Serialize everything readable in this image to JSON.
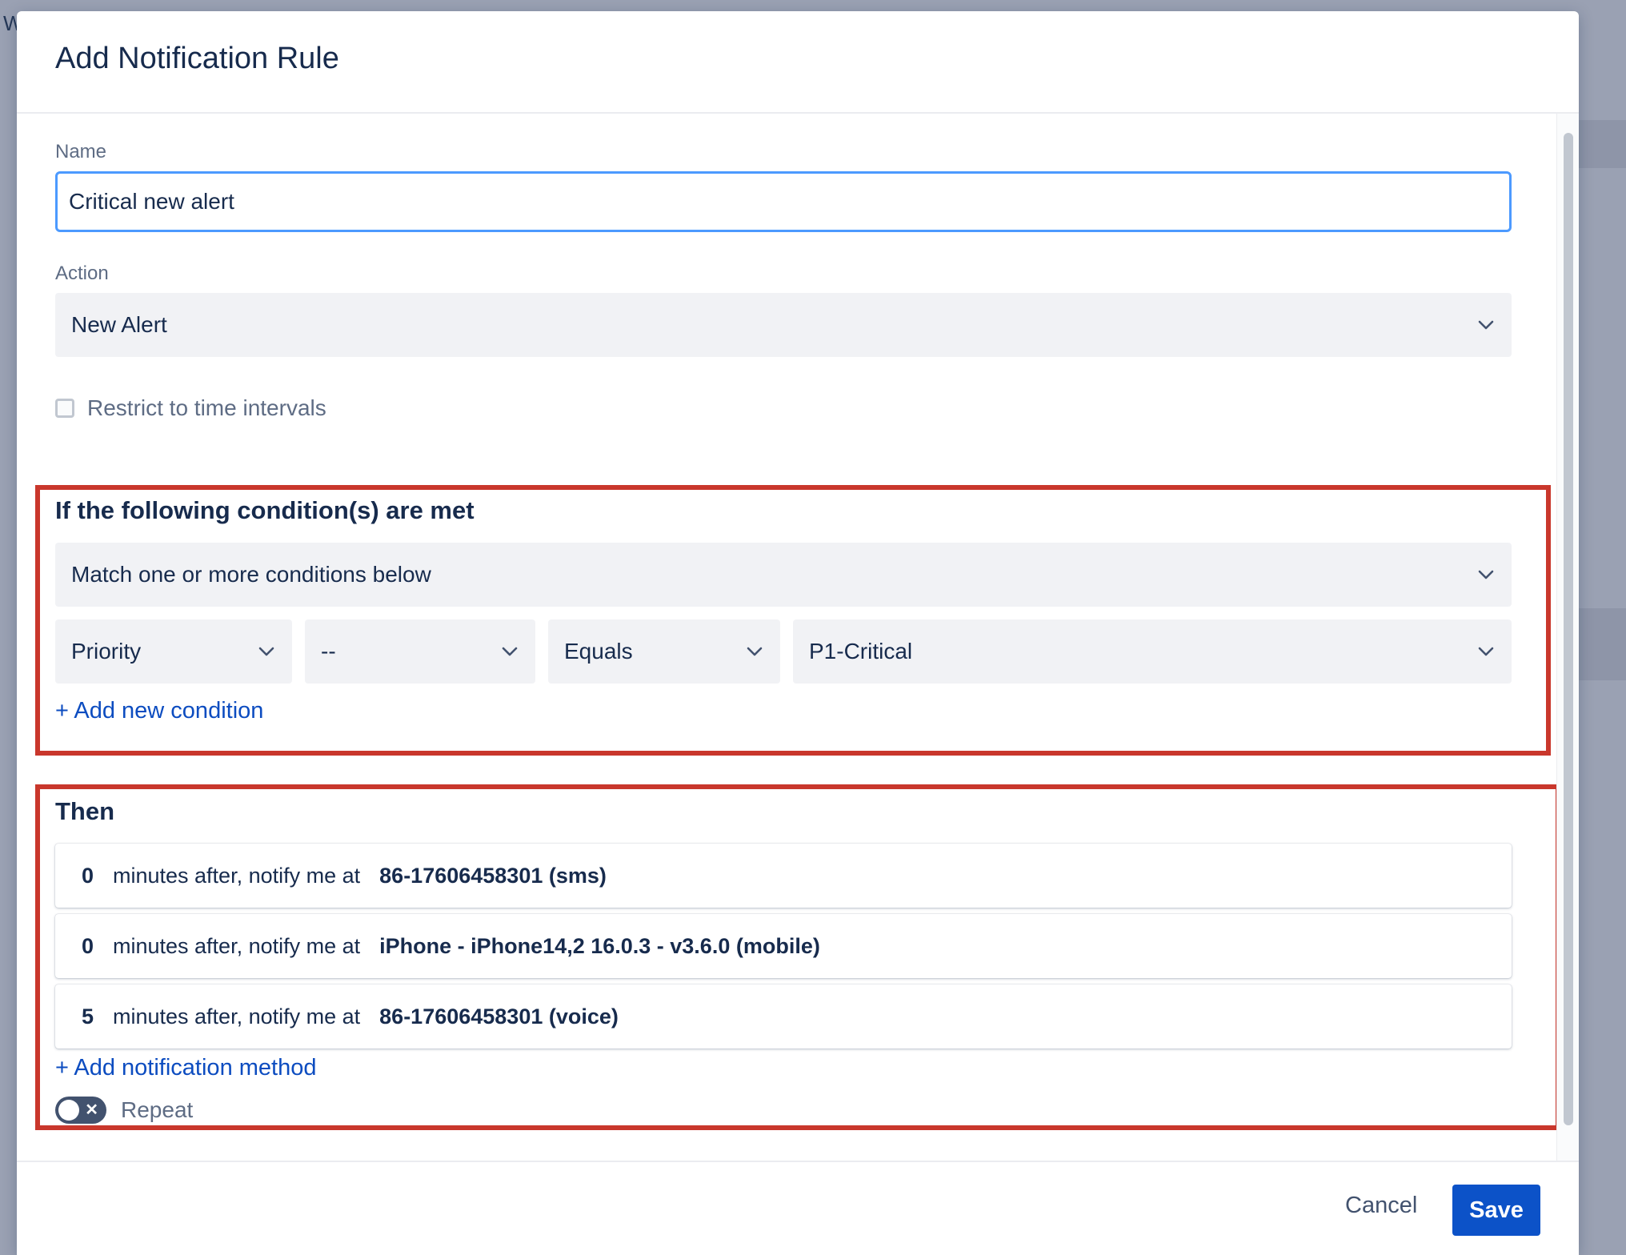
{
  "background": {
    "letter": "W"
  },
  "modal": {
    "title": "Add Notification Rule",
    "name_field": {
      "label": "Name",
      "value": "Critical new alert"
    },
    "action_field": {
      "label": "Action",
      "value": "New Alert"
    },
    "restrict_checkbox": {
      "label": "Restrict to time intervals",
      "checked": false
    },
    "conditions": {
      "title": "If the following condition(s) are met",
      "match_mode": "Match one or more conditions below",
      "rule": {
        "field": "Priority",
        "operator_modifier": "--",
        "operator": "Equals",
        "value": "P1-Critical"
      },
      "add_link": "+ Add new condition"
    },
    "then": {
      "title": "Then",
      "items": [
        {
          "minutes": "0",
          "text": "minutes after, notify me at",
          "target": "86-17606458301 (sms)"
        },
        {
          "minutes": "0",
          "text": "minutes after, notify me at",
          "target": "iPhone - iPhone14,2 16.0.3 - v3.6.0 (mobile)"
        },
        {
          "minutes": "5",
          "text": "minutes after, notify me at",
          "target": "86-17606458301 (voice)"
        }
      ],
      "add_link": "+ Add notification method"
    },
    "repeat": {
      "label": "Repeat",
      "enabled": false
    },
    "footer": {
      "cancel_label": "Cancel",
      "save_label": "Save"
    }
  },
  "colors": {
    "accent": "#0c52c8",
    "highlight": "#c9372c",
    "focus": "#4c9aff"
  }
}
